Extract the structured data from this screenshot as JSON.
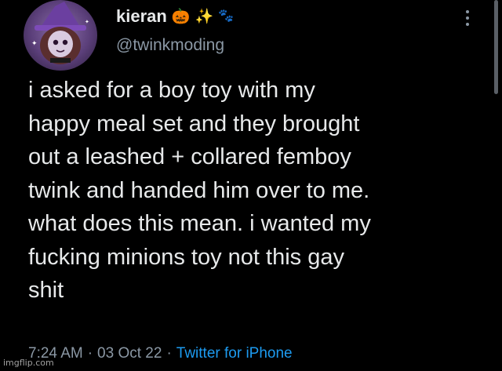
{
  "author": {
    "display_name": "kieran",
    "name_emojis": [
      "🎃",
      "✨",
      "🐾"
    ],
    "handle": "@twinkmoding"
  },
  "tweet": {
    "text": "i asked for a boy toy with my\nhappy meal set and they brought\nout a leashed + collared femboy\ntwink and handed him over to me.\nwhat does this mean. i wanted my\nfucking minions toy not this gay\nshit"
  },
  "meta": {
    "time": "7:24 AM",
    "separator": "·",
    "date": "03 Oct 22",
    "source": "Twitter for iPhone"
  },
  "watermark": "imgflip.com",
  "colors": {
    "background": "#000000",
    "text": "#e7e9ea",
    "secondary": "#8b98a5",
    "link": "#1d9bf0"
  }
}
